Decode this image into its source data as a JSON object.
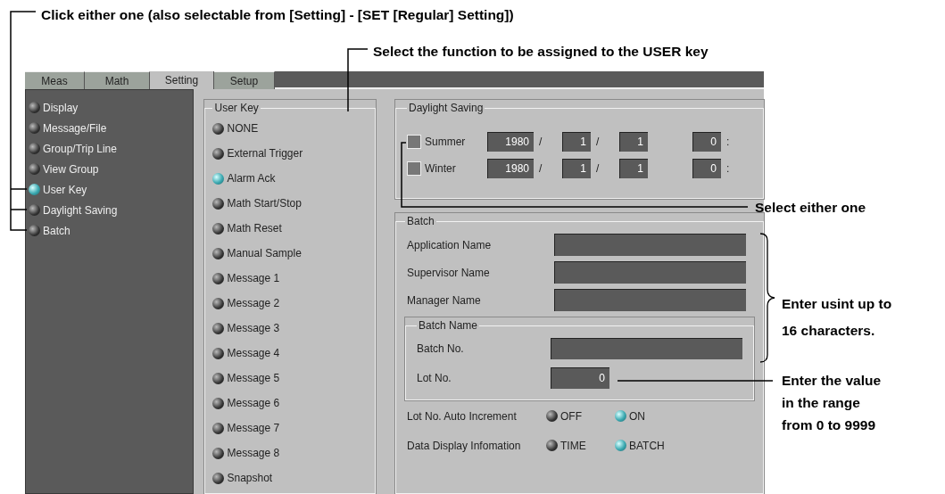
{
  "annotations": [
    {
      "kind": "top",
      "text": "Click either one (also selectable from [Setting] - [SET [Regular] Setting])"
    },
    {
      "kind": "function",
      "text": "Select the function to be assigned to the USER key"
    },
    {
      "kind": "either",
      "text": "Select either one"
    },
    {
      "kind": "chars",
      "text": "Enter usint up to 16 characters."
    },
    {
      "kind": "range",
      "text": "Enter the value in the range from 0 to 9999"
    }
  ],
  "tabs": [
    {
      "label": "Meas",
      "selected": false
    },
    {
      "label": "Math",
      "selected": false
    },
    {
      "label": "Setting",
      "selected": true
    },
    {
      "label": "Setup",
      "selected": false
    }
  ],
  "sidebar": {
    "items": [
      {
        "label": "Display",
        "selected": false
      },
      {
        "label": "Message/File",
        "selected": false
      },
      {
        "label": "Group/Trip Line",
        "selected": false
      },
      {
        "label": "View Group",
        "selected": false
      },
      {
        "label": "User Key",
        "selected": true
      },
      {
        "label": "Daylight Saving",
        "selected": false
      },
      {
        "label": "Batch",
        "selected": false
      }
    ]
  },
  "user_key": {
    "title": "User Key",
    "options": [
      {
        "label": "NONE",
        "selected": false
      },
      {
        "label": "External Trigger",
        "selected": false
      },
      {
        "label": "Alarm Ack",
        "selected": true
      },
      {
        "label": "Math Start/Stop",
        "selected": false
      },
      {
        "label": "Math Reset",
        "selected": false
      },
      {
        "label": "Manual Sample",
        "selected": false
      },
      {
        "label": "Message 1",
        "selected": false
      },
      {
        "label": "Message 2",
        "selected": false
      },
      {
        "label": "Message 3",
        "selected": false
      },
      {
        "label": "Message 4",
        "selected": false
      },
      {
        "label": "Message 5",
        "selected": false
      },
      {
        "label": "Message 6",
        "selected": false
      },
      {
        "label": "Message 7",
        "selected": false
      },
      {
        "label": "Message 8",
        "selected": false
      },
      {
        "label": "Snapshot",
        "selected": false
      }
    ]
  },
  "daylight_saving": {
    "title": "Daylight Saving",
    "rows": [
      {
        "label": "Summer",
        "checked": false,
        "fields": [
          {
            "value": "1980",
            "after": "/"
          },
          {
            "value": "1",
            "after": "/"
          },
          {
            "value": "1"
          },
          {
            "value": "0",
            "after": ":"
          }
        ]
      },
      {
        "label": "Winter",
        "checked": false,
        "fields": [
          {
            "value": "1980",
            "after": "/"
          },
          {
            "value": "1",
            "after": "/"
          },
          {
            "value": "1"
          },
          {
            "value": "0",
            "after": ":"
          }
        ]
      }
    ]
  },
  "batch": {
    "title": "Batch",
    "fields": [
      {
        "label": "Application Name"
      },
      {
        "label": "Supervisor Name"
      },
      {
        "label": "Manager Name"
      }
    ],
    "batch_name": {
      "title": "Batch Name",
      "fields": [
        {
          "label": "Batch No.",
          "kind": "wide"
        },
        {
          "label": "Lot No.",
          "kind": "narrow",
          "value": "0"
        }
      ]
    },
    "options": [
      {
        "label": "Lot No. Auto Increment",
        "choices": [
          {
            "label": "OFF",
            "selected": false
          },
          {
            "label": "ON",
            "selected": true
          }
        ]
      },
      {
        "label": "Data Display Infomation",
        "choices": [
          {
            "label": "TIME",
            "selected": false
          },
          {
            "label": "BATCH",
            "selected": true
          }
        ]
      }
    ]
  }
}
